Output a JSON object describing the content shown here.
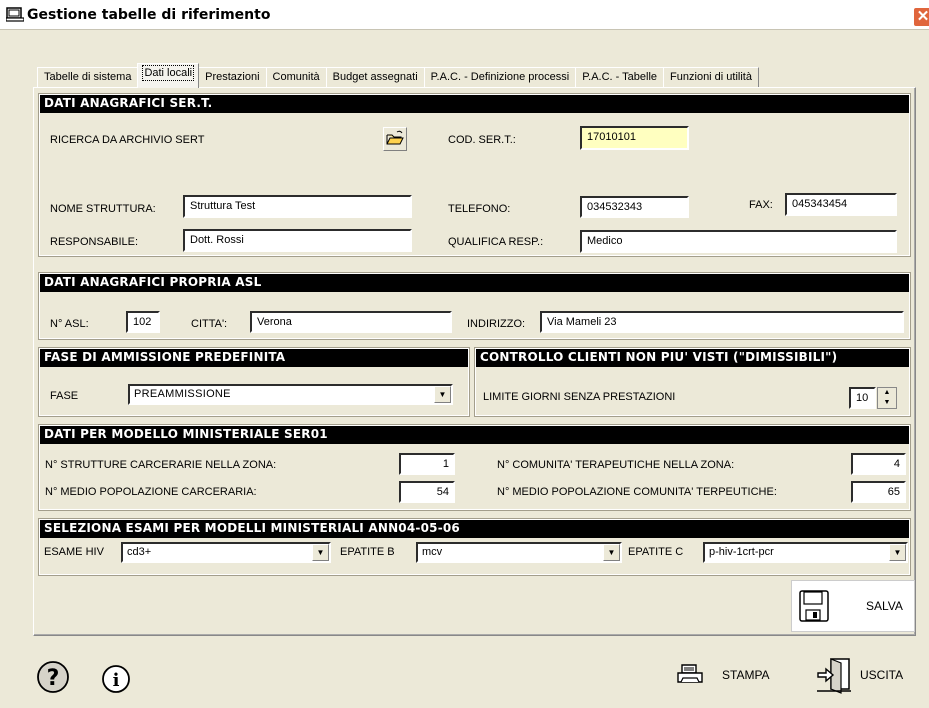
{
  "window": {
    "title": "Gestione tabelle di riferimento"
  },
  "tabs": [
    {
      "label": "Tabelle di sistema"
    },
    {
      "label": "Dati locali"
    },
    {
      "label": "Prestazioni"
    },
    {
      "label": "Comunità"
    },
    {
      "label": "Budget assegnati"
    },
    {
      "label": "P.A.C. - Definizione processi"
    },
    {
      "label": "P.A.C. - Tabelle"
    },
    {
      "label": "Funzioni di utilità"
    }
  ],
  "sert": {
    "header": "DATI ANAGRAFICI SER.T.",
    "ricerca_label": "RICERCA DA ARCHIVIO SERT",
    "cod_label": "COD. SER.T.:",
    "cod_value": "17010101",
    "nome_label": "NOME STRUTTURA:",
    "nome_value": "Struttura Test",
    "telefono_label": "TELEFONO:",
    "telefono_value": "034532343",
    "fax_label": "FAX:",
    "fax_value": "045343454",
    "resp_label": "RESPONSABILE:",
    "resp_value": "Dott. Rossi",
    "qualifica_label": "QUALIFICA RESP.:",
    "qualifica_value": "Medico"
  },
  "asl": {
    "header": "DATI ANAGRAFICI PROPRIA ASL",
    "nasl_label": "N° ASL:",
    "nasl_value": "102",
    "citta_label": "CITTA':",
    "citta_value": "Verona",
    "indirizzo_label": "INDIRIZZO:",
    "indirizzo_value": "Via Mameli 23"
  },
  "fase": {
    "header": "FASE DI AMMISSIONE PREDEFINITA",
    "label": "FASE",
    "value": "PREAMMISSIONE"
  },
  "controllo": {
    "header": "CONTROLLO CLIENTI NON PIU' VISTI (\"DIMISSIBILI\")",
    "label": "LIMITE GIORNI SENZA PRESTAZIONI",
    "value": "10"
  },
  "ser01": {
    "header": "DATI PER MODELLO MINISTERIALE SER01",
    "strutture_label": "N° STRUTTURE CARCERARIE NELLA ZONA:",
    "strutture_value": "1",
    "popolazione_label": "N° MEDIO POPOLAZIONE CARCERARIA:",
    "popolazione_value": "54",
    "comunita_label": "N° COMUNITA' TERAPEUTICHE NELLA ZONA:",
    "comunita_value": "4",
    "pop_comunita_label": "N° MEDIO POPOLAZIONE COMUNITA' TERPEUTICHE:",
    "pop_comunita_value": "65"
  },
  "esami": {
    "header": "SELEZIONA ESAMI PER MODELLI MINISTERIALI ANN04-05-06",
    "hiv_label": "ESAME HIV",
    "hiv_value": "cd3+",
    "epb_label": "EPATITE B",
    "epb_value": "mcv",
    "epc_label": "EPATITE C",
    "epc_value": "p-hiv-1crt-pcr"
  },
  "actions": {
    "salva": "SALVA",
    "stampa": "STAMPA",
    "uscita": "USCITA"
  }
}
